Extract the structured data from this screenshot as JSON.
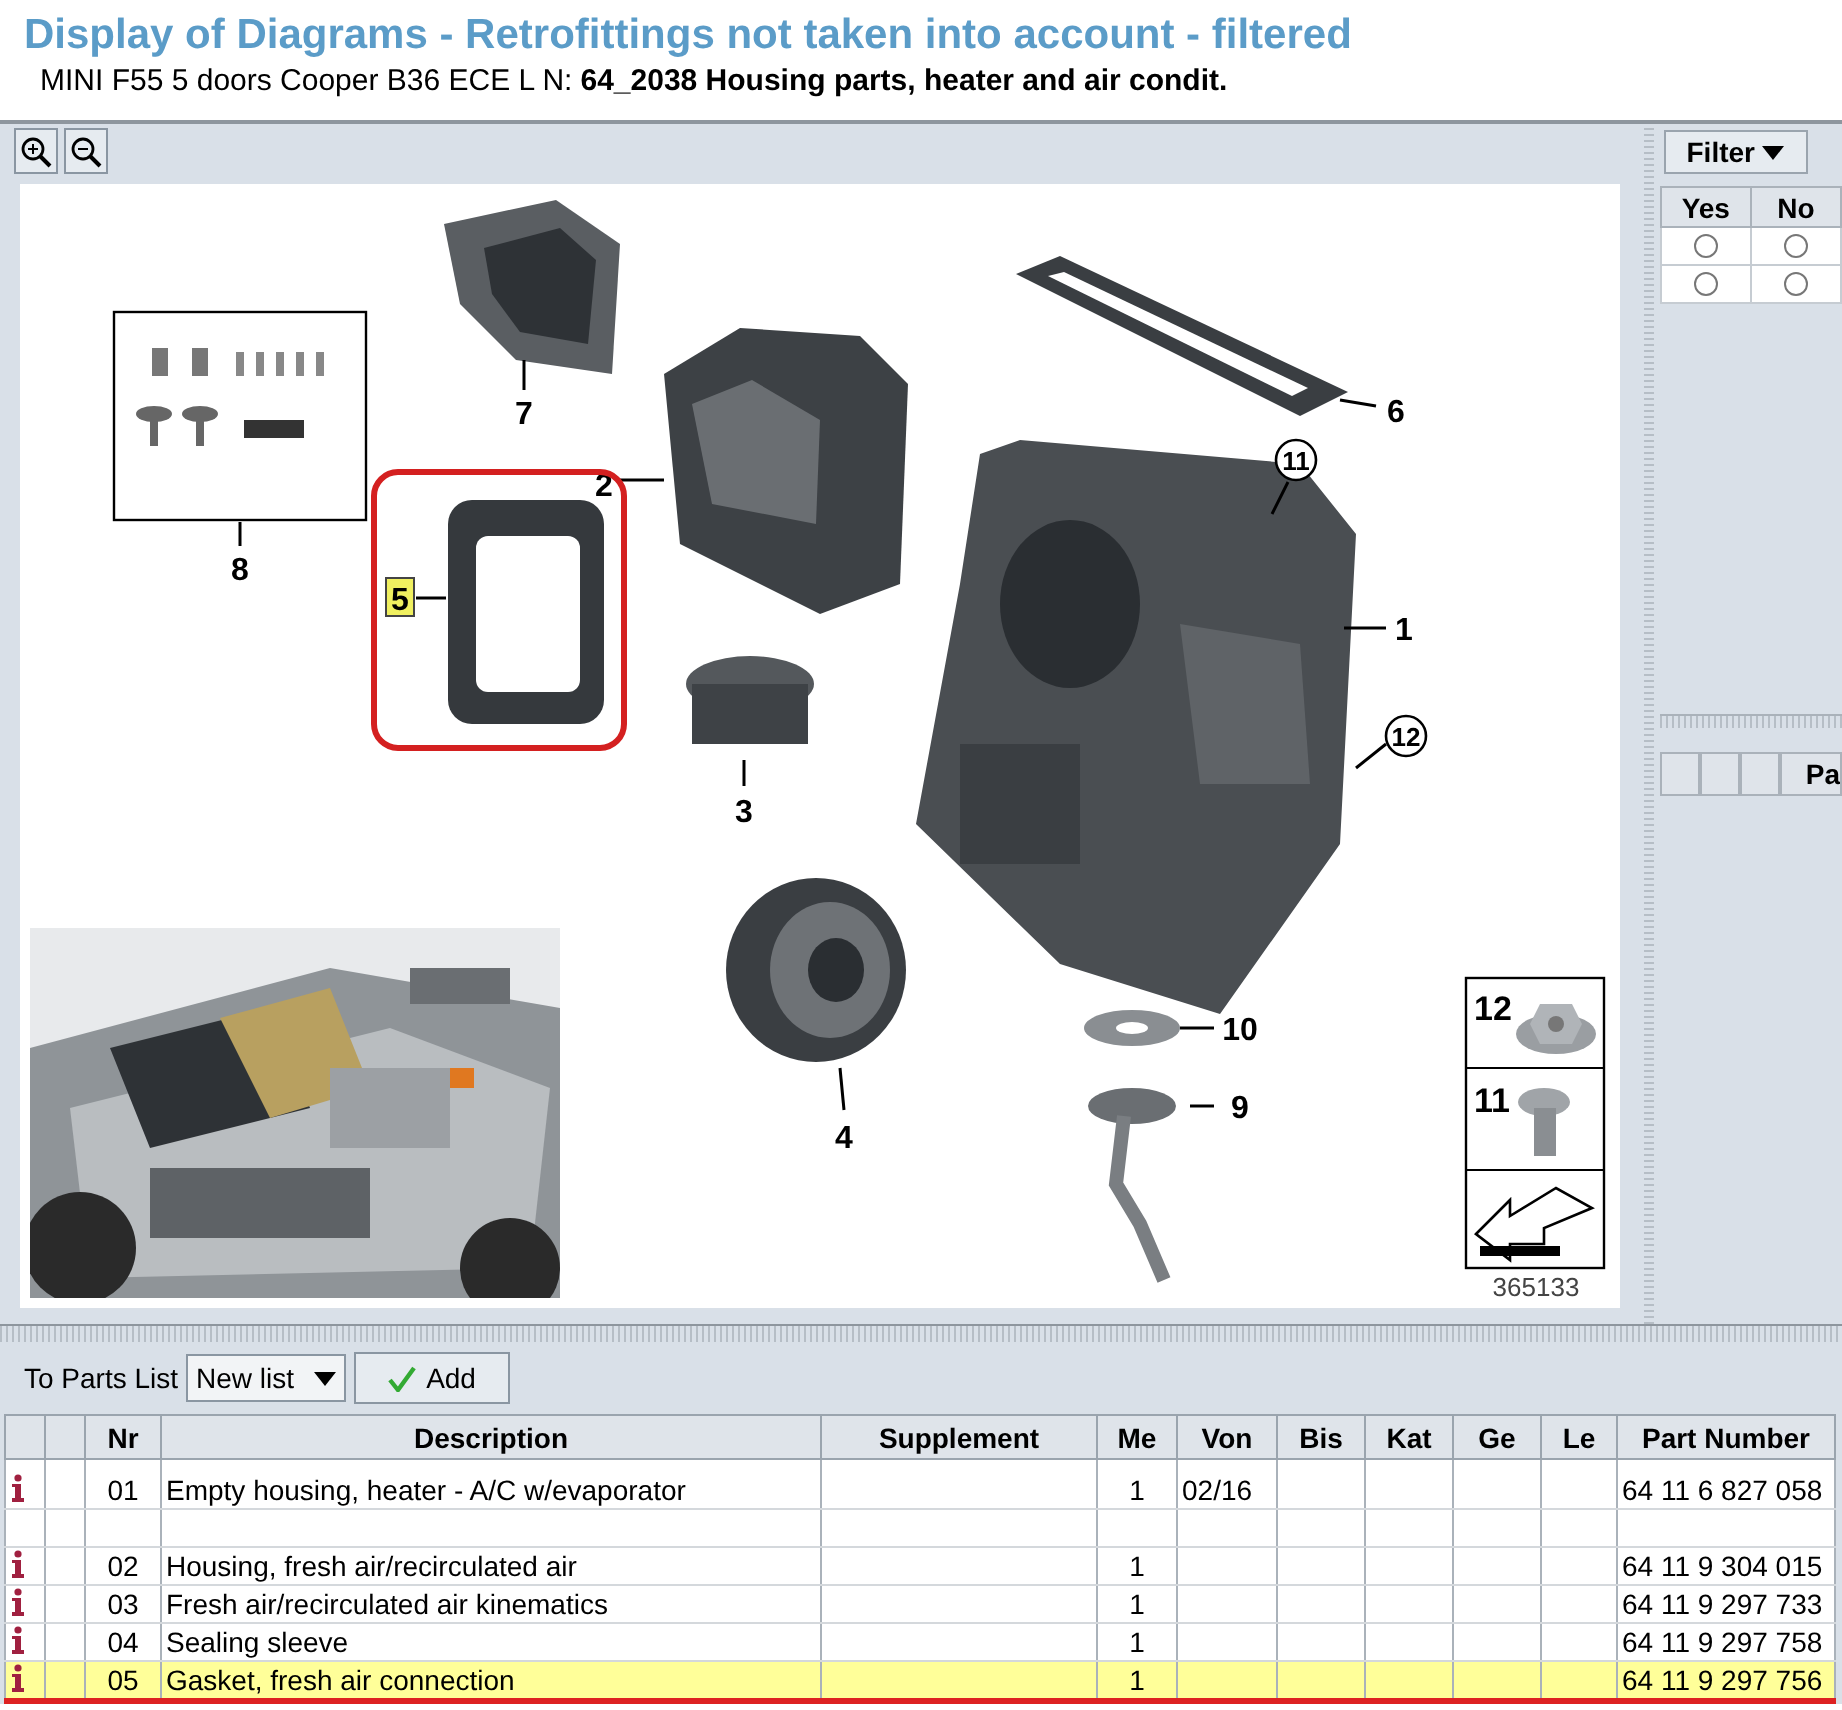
{
  "window": {
    "title": "Display of Diagrams - Retrofittings not taken into account - filtered"
  },
  "subtitle": {
    "vehicle": "MINI F55 5 doors Cooper B36 ECE  L N:",
    "group": "64_2038 Housing parts, heater and air condit."
  },
  "diagram": {
    "callouts": [
      {
        "label": "7",
        "kind": "plain",
        "selected": false
      },
      {
        "label": "8",
        "kind": "plain",
        "selected": false
      },
      {
        "label": "6",
        "kind": "plain",
        "selected": false
      },
      {
        "label": "11",
        "kind": "circled",
        "selected": false
      },
      {
        "label": "2",
        "kind": "plain",
        "selected": false
      },
      {
        "label": "5",
        "kind": "plain",
        "selected": true
      },
      {
        "label": "1",
        "kind": "plain",
        "selected": false
      },
      {
        "label": "12",
        "kind": "circled",
        "selected": false
      },
      {
        "label": "3",
        "kind": "plain",
        "selected": false
      },
      {
        "label": "4",
        "kind": "plain",
        "selected": false
      },
      {
        "label": "10",
        "kind": "plain",
        "selected": false
      },
      {
        "label": "9",
        "kind": "plain",
        "selected": false
      }
    ],
    "fasteners": [
      {
        "label": "12"
      },
      {
        "label": "11"
      }
    ],
    "image_number": "365133"
  },
  "filter": {
    "label": "Filter",
    "columns": [
      "Yes",
      "No"
    ],
    "rows": [
      {
        "options": [
          {
            "selected": false
          },
          {
            "selected": false
          }
        ]
      },
      {
        "options": [
          {
            "selected": false
          },
          {
            "selected": false
          }
        ]
      }
    ]
  },
  "lower_right_panel": {
    "column_4": "Pa"
  },
  "parts_list": {
    "label": "To Parts List",
    "list": "New list",
    "add_button": "Add"
  },
  "table": {
    "columns": [
      "Nr",
      "Description",
      "Supplement",
      "Me",
      "Von",
      "Bis",
      "Kat",
      "Ge",
      "Le",
      "Part Number"
    ],
    "rows": [
      {
        "info": true,
        "selected": false,
        "nr": "01",
        "description": "Empty housing, heater - A/C w/evaporator",
        "me": "1",
        "von": "02/16",
        "part_number": "64 11 6 827 058"
      },
      {
        "info": false,
        "selected": false
      },
      {
        "info": true,
        "selected": false,
        "nr": "02",
        "description": "Housing, fresh air/recirculated air",
        "me": "1",
        "part_number": "64 11 9 304 015"
      },
      {
        "info": true,
        "selected": false,
        "nr": "03",
        "description": "Fresh air/recirculated air kinematics",
        "me": "1",
        "part_number": "64 11 9 297 733"
      },
      {
        "info": true,
        "selected": false,
        "nr": "04",
        "description": "Sealing sleeve",
        "me": "1",
        "part_number": "64 11 9 297 758"
      },
      {
        "info": true,
        "selected": true,
        "nr": "05",
        "description": "Gasket, fresh air connection",
        "me": "1",
        "part_number": "64 11 9 297 756"
      }
    ]
  }
}
